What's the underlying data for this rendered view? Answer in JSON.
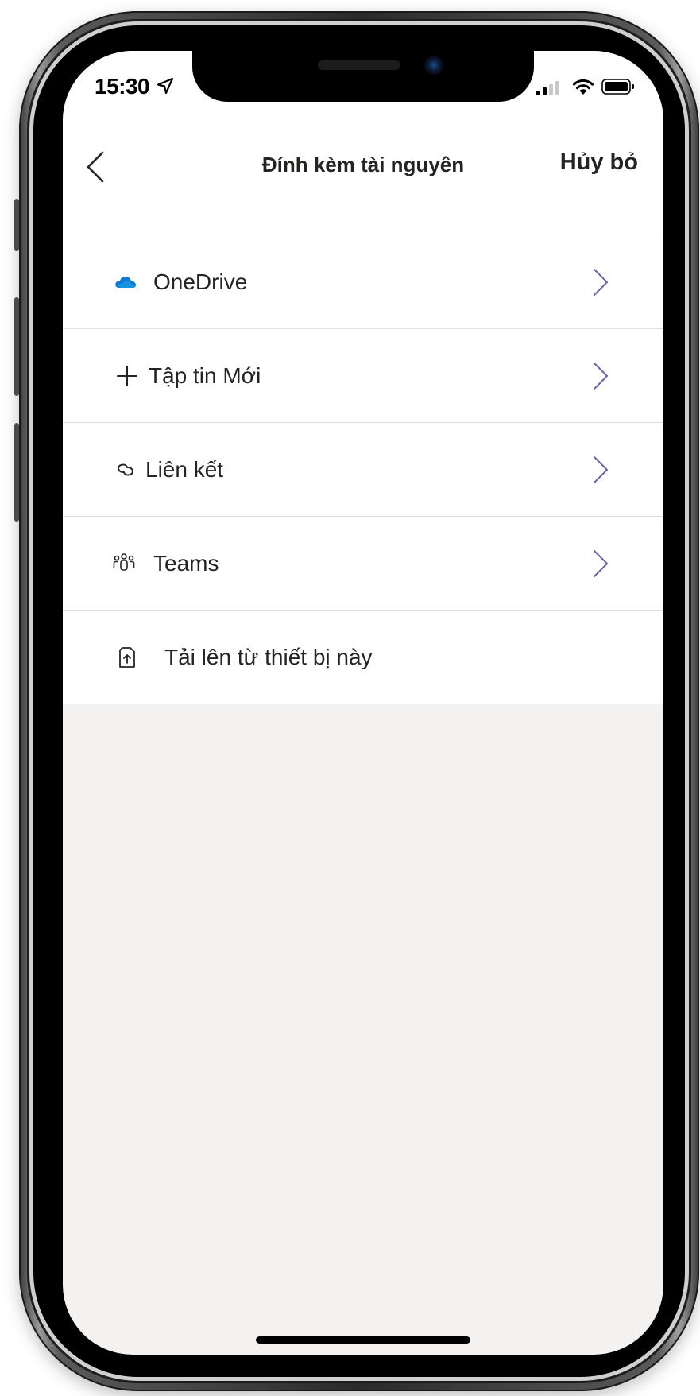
{
  "status_bar": {
    "time": "15:30"
  },
  "header": {
    "title": "Đính kèm tài nguyên",
    "cancel_label": "Hủy bỏ"
  },
  "menu": {
    "items": [
      {
        "label": "OneDrive",
        "icon": "onedrive-cloud-icon",
        "has_chevron": true
      },
      {
        "label": "Tập tin Mới",
        "icon": "plus-icon",
        "has_chevron": true
      },
      {
        "label": "Liên kết",
        "icon": "link-icon",
        "has_chevron": true
      },
      {
        "label": "Teams",
        "icon": "teams-people-icon",
        "has_chevron": true
      },
      {
        "label": "Tải lên từ thiết bị này",
        "icon": "upload-file-icon",
        "has_chevron": false
      }
    ]
  },
  "colors": {
    "chevron": "#6264a7",
    "onedrive": "#0f78d4",
    "text": "#252423",
    "background": "#f3f2f1"
  }
}
